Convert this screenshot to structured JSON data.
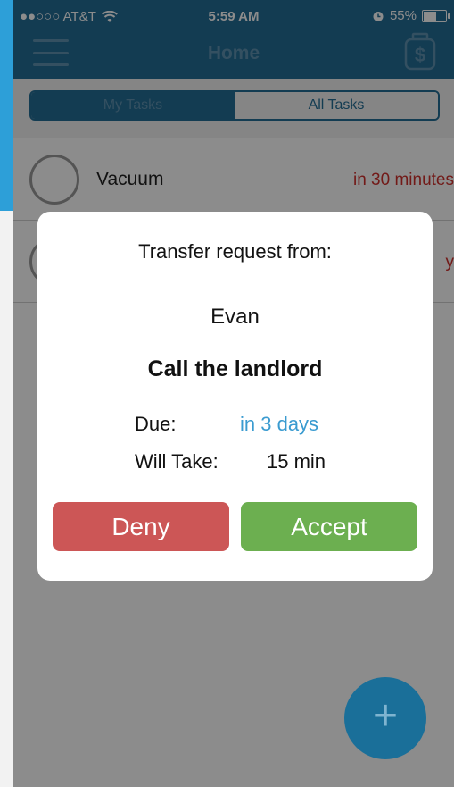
{
  "status": {
    "carrier": "●●○○○ AT&T",
    "time": "5:59 AM",
    "battery": "55%"
  },
  "nav": {
    "title": "Home"
  },
  "tabs": [
    {
      "label": "My Tasks"
    },
    {
      "label": "All Tasks"
    }
  ],
  "tasks": [
    {
      "title": "Vacuum",
      "due": "in 30 minutes"
    },
    {
      "title": "",
      "due": "y"
    }
  ],
  "modal": {
    "heading": "Transfer request from:",
    "from_name": "Evan",
    "task_title": "Call the landlord",
    "due_label": "Due:",
    "due_value": "in 3 days",
    "take_label": "Will Take:",
    "take_value": "15 min",
    "deny_label": "Deny",
    "accept_label": "Accept"
  },
  "fab": {
    "label": "+"
  },
  "colors": {
    "nav": "#246d95",
    "deny": "#cc5656",
    "accept": "#6caf50",
    "due": "#d0312d",
    "link": "#3a9bd0"
  }
}
